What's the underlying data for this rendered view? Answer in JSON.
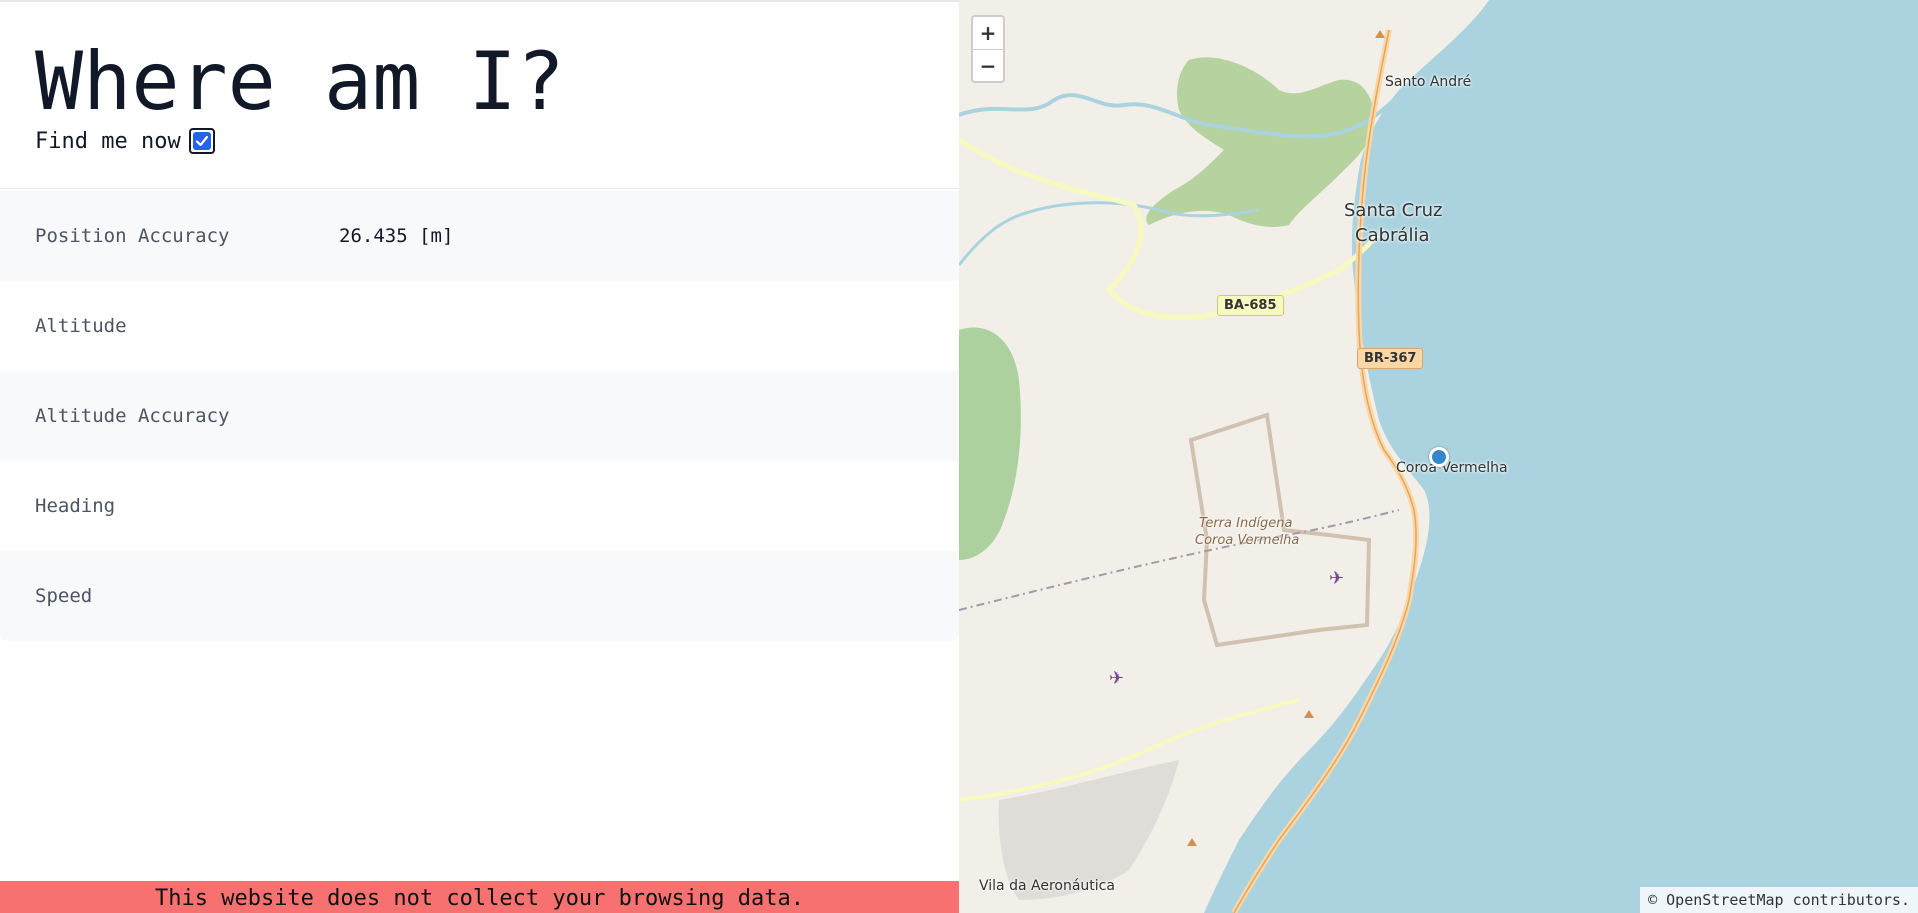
{
  "page": {
    "title": "Where am I?",
    "find_label": "Find me now",
    "find_checked": true
  },
  "stats": [
    {
      "label": "Position Accuracy",
      "value": "26.435 [m]"
    },
    {
      "label": "Altitude",
      "value": ""
    },
    {
      "label": "Altitude Accuracy",
      "value": ""
    },
    {
      "label": "Heading",
      "value": ""
    },
    {
      "label": "Speed",
      "value": ""
    }
  ],
  "footer": {
    "text": "This website does not collect your browsing data."
  },
  "map": {
    "zoom_in": "+",
    "zoom_out": "−",
    "attribution": "© OpenStreetMap contributors.",
    "labels": {
      "santo_andre": "Santo André",
      "santa_cruz_1": "Santa Cruz",
      "santa_cruz_2": "Cabrália",
      "coroa_vermelha": "Coroa Vermelha",
      "terra_indigena_1": "Terra Indígena",
      "terra_indigena_2": "Coroa Vermelha",
      "vila": "Vila da Aeronáutica"
    },
    "roads": {
      "ba685": "BA-685",
      "br367": "BR-367"
    },
    "colors": {
      "water": "#aad3df",
      "land": "#f2efe9",
      "wetland": "#b5d29f",
      "location": "#3388cc",
      "footer": "#f87171"
    }
  }
}
